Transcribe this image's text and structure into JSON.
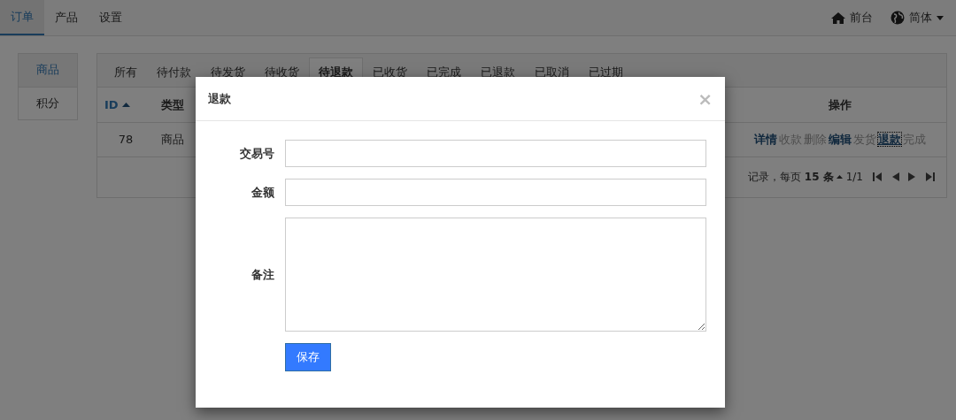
{
  "navbar": {
    "items": [
      {
        "label": "订单",
        "selected": true
      },
      {
        "label": "产品",
        "selected": false
      },
      {
        "label": "设置",
        "selected": false
      }
    ],
    "right": [
      {
        "kind": "home",
        "label": "前台",
        "dropdown": false
      },
      {
        "kind": "language",
        "label": "简体",
        "dropdown": true
      }
    ]
  },
  "sidebar": {
    "items": [
      {
        "label": "商品",
        "selected": true
      },
      {
        "label": "积分",
        "selected": false
      }
    ]
  },
  "status_tabs": [
    {
      "label": "所有",
      "selected": false
    },
    {
      "label": "待付款",
      "selected": false
    },
    {
      "label": "待发货",
      "selected": false
    },
    {
      "label": "待收货",
      "selected": false
    },
    {
      "label": "待退款",
      "selected": true
    },
    {
      "label": "已收货",
      "selected": false
    },
    {
      "label": "已完成",
      "selected": false
    },
    {
      "label": "已退款",
      "selected": false
    },
    {
      "label": "已取消",
      "selected": false
    },
    {
      "label": "已过期",
      "selected": false
    }
  ],
  "table": {
    "columns": [
      {
        "label": "ID",
        "sorted": true
      },
      {
        "label": "类型",
        "sorted": false
      },
      {
        "label": "操作",
        "sorted": false
      }
    ],
    "rows": [
      {
        "cells": [
          "78",
          "商品"
        ],
        "actions": [
          {
            "label": "详情",
            "disabled": false,
            "focused": false
          },
          {
            "label": "收款",
            "disabled": true,
            "focused": false
          },
          {
            "label": "删除",
            "disabled": true,
            "focused": false
          },
          {
            "label": "编辑",
            "disabled": false,
            "focused": false
          },
          {
            "label": "发货",
            "disabled": true,
            "focused": false
          },
          {
            "label": "退款",
            "disabled": false,
            "focused": true
          },
          {
            "label": "完成",
            "disabled": true,
            "focused": false
          }
        ]
      }
    ]
  },
  "pager": {
    "info": "记录，每页",
    "page_size": "15 条",
    "page": "1/1"
  },
  "modal": {
    "title": "退款",
    "close": "×",
    "fields": [
      {
        "label": "交易号",
        "kind": "input"
      },
      {
        "label": "金额",
        "kind": "input"
      },
      {
        "label": "备注",
        "kind": "textarea"
      }
    ],
    "button": "保存"
  }
}
